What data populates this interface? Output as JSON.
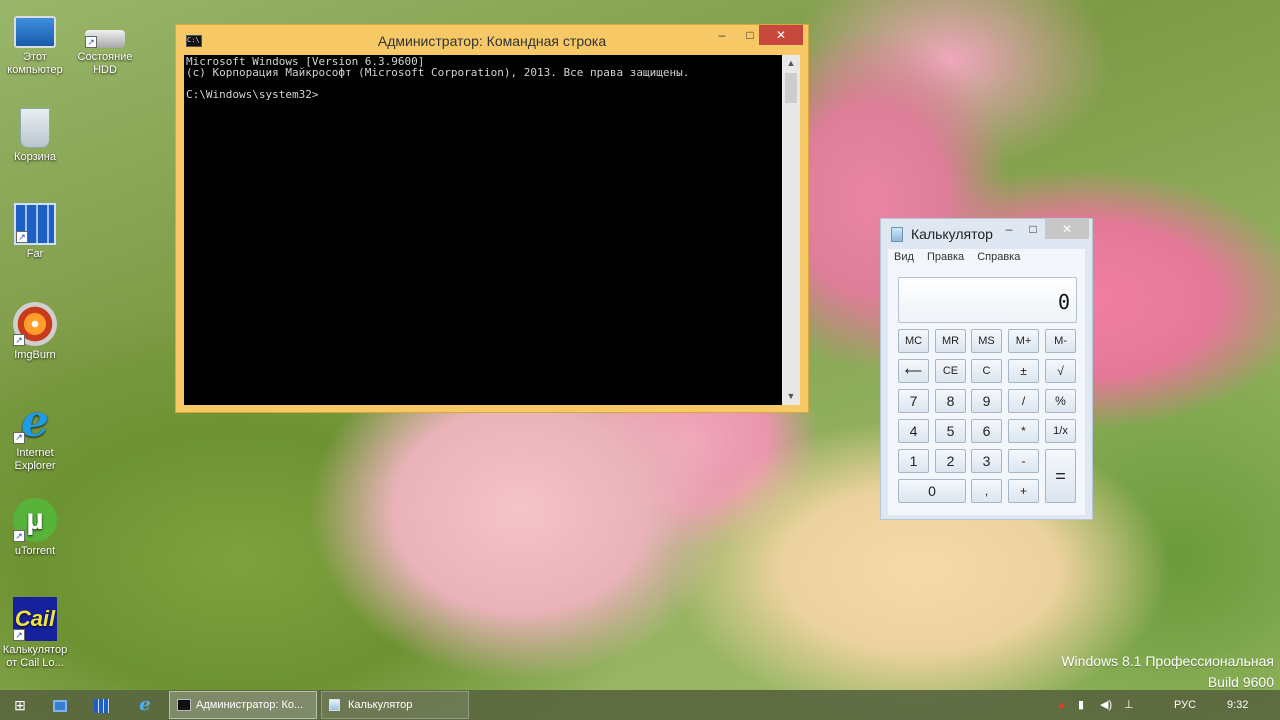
{
  "desktop": {
    "icons": [
      {
        "label_line1": "Этот",
        "label_line2": "компьютер",
        "icon": "computer-icon"
      },
      {
        "label_line1": "Состояние",
        "label_line2": "HDD",
        "icon": "hdd-icon"
      },
      {
        "label_line1": "Корзина",
        "label_line2": "",
        "icon": "recycle-bin-icon"
      },
      {
        "label_line1": "Far",
        "label_line2": "",
        "icon": "far-manager-icon"
      },
      {
        "label_line1": "ImgBurn",
        "label_line2": "",
        "icon": "imgburn-disc-icon"
      },
      {
        "label_line1": "Internet",
        "label_line2": "Explorer",
        "icon": "internet-explorer-icon"
      },
      {
        "label_line1": "uTorrent",
        "label_line2": "",
        "icon": "utorrent-icon"
      },
      {
        "label_line1": "Калькулятор",
        "label_line2": "от Cail Lo...",
        "icon": "cail-calculator-icon"
      }
    ],
    "watermark": {
      "line1": "Windows 8.1 Профессиональная",
      "line2": "Build 9600"
    }
  },
  "cmd_window": {
    "title": "Администратор: Командная строка",
    "minimize": "–",
    "maximize": "□",
    "close": "✕",
    "console_lines": [
      "Microsoft Windows [Version 6.3.9600]",
      "(c) Корпорация Майкрософт (Microsoft Corporation), 2013. Все права защищены.",
      "",
      "C:\\Windows\\system32>"
    ]
  },
  "calculator": {
    "title": "Калькулятор",
    "minimize": "–",
    "maximize": "□",
    "close": "✕",
    "menu": [
      "Вид",
      "Правка",
      "Справка"
    ],
    "display": "0",
    "keys": {
      "mc": "MC",
      "mr": "MR",
      "ms": "MS",
      "mplus": "M+",
      "mminus": "M-",
      "back": "⟵",
      "ce": "CE",
      "c": "C",
      "plusminus": "±",
      "sqrt": "√",
      "n7": "7",
      "n8": "8",
      "n9": "9",
      "div": "/",
      "pct": "%",
      "n4": "4",
      "n5": "5",
      "n6": "6",
      "mul": "*",
      "recip": "1/x",
      "n1": "1",
      "n2": "2",
      "n3": "3",
      "minus": "-",
      "eq": "=",
      "n0": "0",
      "dot": ",",
      "plus": "+"
    }
  },
  "taskbar": {
    "start_icon": "windows-start-icon",
    "pinned": [
      "file-explorer-icon",
      "far-manager-icon",
      "internet-explorer-icon"
    ],
    "tasks": [
      {
        "label": "Администратор: Ко...",
        "active": true
      },
      {
        "label": "Калькулятор",
        "active": false
      }
    ],
    "tray": {
      "language": "РУС",
      "time": "9:32"
    }
  }
}
